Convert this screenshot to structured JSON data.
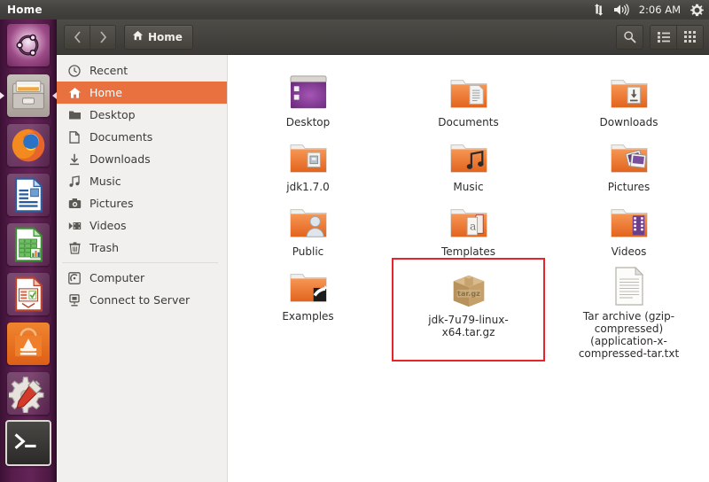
{
  "panel": {
    "title": "Home",
    "clock": "2:06 AM",
    "indicators": [
      {
        "name": "network-icon",
        "glyph": "network"
      },
      {
        "name": "volume-icon",
        "glyph": "volume"
      },
      {
        "name": "session-gear-icon",
        "glyph": "gear"
      }
    ]
  },
  "launcher": {
    "items": [
      {
        "label": "Ubuntu Dash Home",
        "name": "launcher-item-dash"
      },
      {
        "label": "Files",
        "name": "launcher-item-files"
      },
      {
        "label": "Firefox Web Browser",
        "name": "launcher-item-firefox"
      },
      {
        "label": "LibreOffice Writer",
        "name": "launcher-item-libreoffice-writer"
      },
      {
        "label": "LibreOffice Calc",
        "name": "launcher-item-libreoffice-calc"
      },
      {
        "label": "LibreOffice Impress",
        "name": "launcher-item-libreoffice-impress"
      },
      {
        "label": "Ubuntu Software Center",
        "name": "launcher-item-software-center"
      },
      {
        "label": "System Settings",
        "name": "launcher-item-system-settings"
      },
      {
        "label": "Terminal",
        "name": "launcher-item-terminal"
      }
    ]
  },
  "toolbar": {
    "back_label": "‹",
    "forward_label": "›",
    "path_label": "Home",
    "search_label": "",
    "list_view_label": "",
    "grid_view_label": ""
  },
  "sidebar": {
    "places": [
      {
        "label": "Recent",
        "icon": "clock-icon",
        "selected": false
      },
      {
        "label": "Home",
        "icon": "home-icon",
        "selected": true
      },
      {
        "label": "Desktop",
        "icon": "desktop-folder-icon",
        "selected": false
      },
      {
        "label": "Documents",
        "icon": "document-icon",
        "selected": false
      },
      {
        "label": "Downloads",
        "icon": "download-icon",
        "selected": false
      },
      {
        "label": "Music",
        "icon": "music-note-icon",
        "selected": false
      },
      {
        "label": "Pictures",
        "icon": "camera-icon",
        "selected": false
      },
      {
        "label": "Videos",
        "icon": "video-icon",
        "selected": false
      },
      {
        "label": "Trash",
        "icon": "trash-icon",
        "selected": false
      }
    ],
    "devices": [
      {
        "label": "Computer",
        "icon": "computer-icon",
        "selected": false
      },
      {
        "label": "Connect to Server",
        "icon": "server-icon",
        "selected": false
      }
    ]
  },
  "files": [
    {
      "label": "Desktop",
      "icon": "desktop-window-icon",
      "highlighted": false
    },
    {
      "label": "Documents",
      "icon": "folder-documents-icon",
      "highlighted": false
    },
    {
      "label": "Downloads",
      "icon": "folder-downloads-icon",
      "highlighted": false
    },
    {
      "label": "jdk1.7.0",
      "icon": "folder-icon",
      "highlighted": false
    },
    {
      "label": "Music",
      "icon": "folder-music-icon",
      "highlighted": false
    },
    {
      "label": "Pictures",
      "icon": "folder-pictures-icon",
      "highlighted": false
    },
    {
      "label": "Public",
      "icon": "folder-public-icon",
      "highlighted": false
    },
    {
      "label": "Templates",
      "icon": "folder-templates-icon",
      "highlighted": false
    },
    {
      "label": "Videos",
      "icon": "folder-videos-icon",
      "highlighted": false
    },
    {
      "label": "Examples",
      "icon": "folder-examples-icon",
      "highlighted": false
    },
    {
      "label": "jdk-7u79-linux-x64.tar.gz",
      "icon": "targz-archive-icon",
      "highlighted": true
    },
    {
      "label": "Tar archive (gzip-compressed) (application-x-compressed-tar.txt",
      "icon": "text-file-icon",
      "highlighted": false
    }
  ],
  "colors": {
    "panel_bg": "#454340",
    "launcher_bg": "#5c2150",
    "selection_orange": "#e9703f",
    "highlight_red": "#e8232a",
    "sidebar_bg": "#f1f0ef",
    "folder_orange": "#ef7a35"
  }
}
